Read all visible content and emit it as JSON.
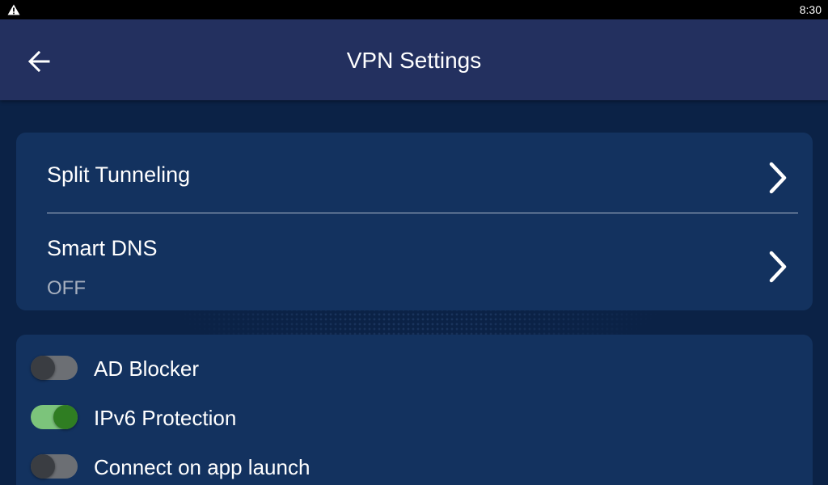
{
  "status_bar": {
    "time": "8:30",
    "warning_icon": "warning-triangle-icon"
  },
  "app_bar": {
    "title": "VPN Settings",
    "back_icon": "arrow-left-icon"
  },
  "nav_items": [
    {
      "label": "Split Tunneling",
      "icon": "chevron-right-icon"
    },
    {
      "label": "Smart DNS",
      "value": "OFF",
      "icon": "chevron-right-icon"
    }
  ],
  "toggles": [
    {
      "label": "AD Blocker",
      "state": "off"
    },
    {
      "label": "IPv6 Protection",
      "state": "on"
    },
    {
      "label": "Connect on app launch",
      "state": "off"
    }
  ],
  "colors": {
    "background": "#0b2246",
    "app_bar": "#23305f",
    "card": "#13325f",
    "toggle_on_track": "#7cc47b",
    "toggle_on_thumb": "#2f7d22",
    "toggle_off_track": "#6c6f74",
    "toggle_off_thumb": "#3a3d42",
    "secondary_text": "#a7b0bf"
  }
}
